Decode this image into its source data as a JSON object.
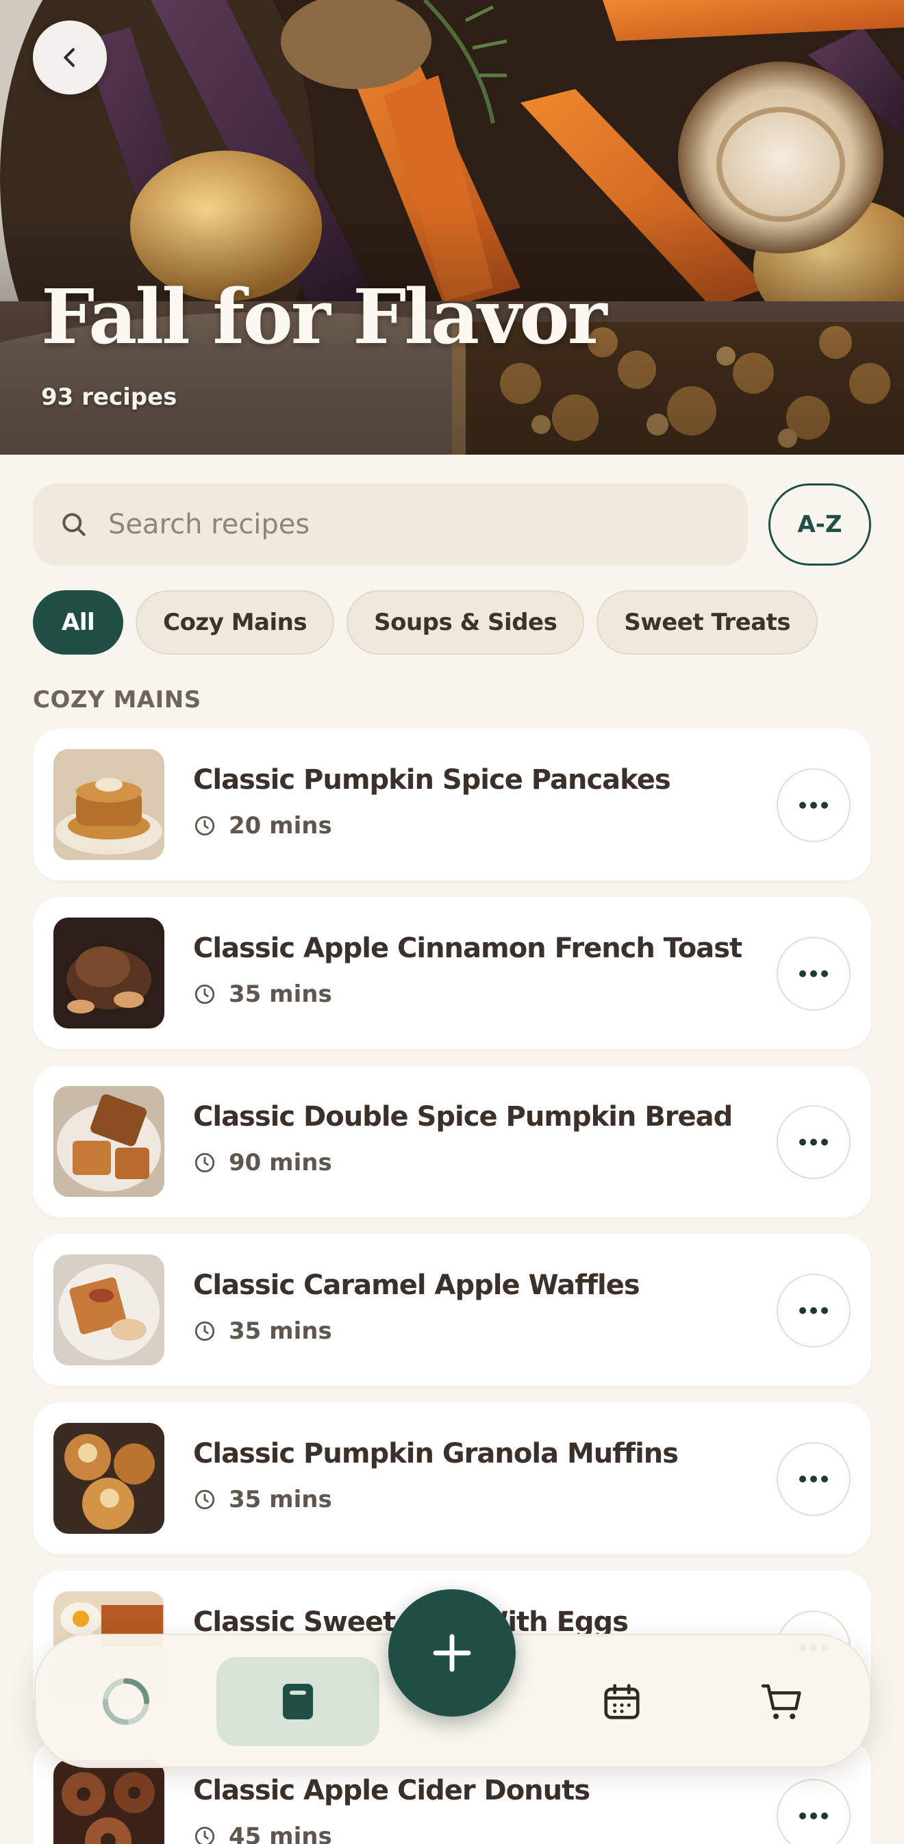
{
  "hero": {
    "title": "Fall for Flavor",
    "count": "93 recipes",
    "back_icon": "chevron-left-icon"
  },
  "search": {
    "placeholder": "Search recipes",
    "icon": "search-icon",
    "sort_label": "A-Z"
  },
  "filters": [
    {
      "label": "All",
      "active": true
    },
    {
      "label": "Cozy Mains",
      "active": false
    },
    {
      "label": "Soups & Sides",
      "active": false
    },
    {
      "label": "Sweet Treats",
      "active": false
    }
  ],
  "section": {
    "title": "COZY MAINS"
  },
  "recipes": [
    {
      "title": "Classic Pumpkin Spice Pancakes",
      "time": "20 mins"
    },
    {
      "title": "Classic Apple Cinnamon French Toast",
      "time": "35 mins"
    },
    {
      "title": "Classic Double Spice Pumpkin Bread",
      "time": "90 mins"
    },
    {
      "title": "Classic Caramel Apple Waffles",
      "time": "35 mins"
    },
    {
      "title": "Classic Pumpkin Granola Muffins",
      "time": "35 mins"
    },
    {
      "title": "Classic Sweet Po      h With Eggs",
      "time": ""
    },
    {
      "title": "Classic Apple Cider Donuts",
      "time": "45 mins"
    }
  ],
  "nav": {
    "items": [
      "loading-icon",
      "book-icon",
      "calendar-icon",
      "cart-icon"
    ],
    "active": "book-icon",
    "fab_icon": "plus-icon"
  },
  "colors": {
    "primary": "#1f4f45",
    "background": "#f8f5ee",
    "chip": "#efe8dc",
    "nav_active": "#d6e3d6"
  }
}
